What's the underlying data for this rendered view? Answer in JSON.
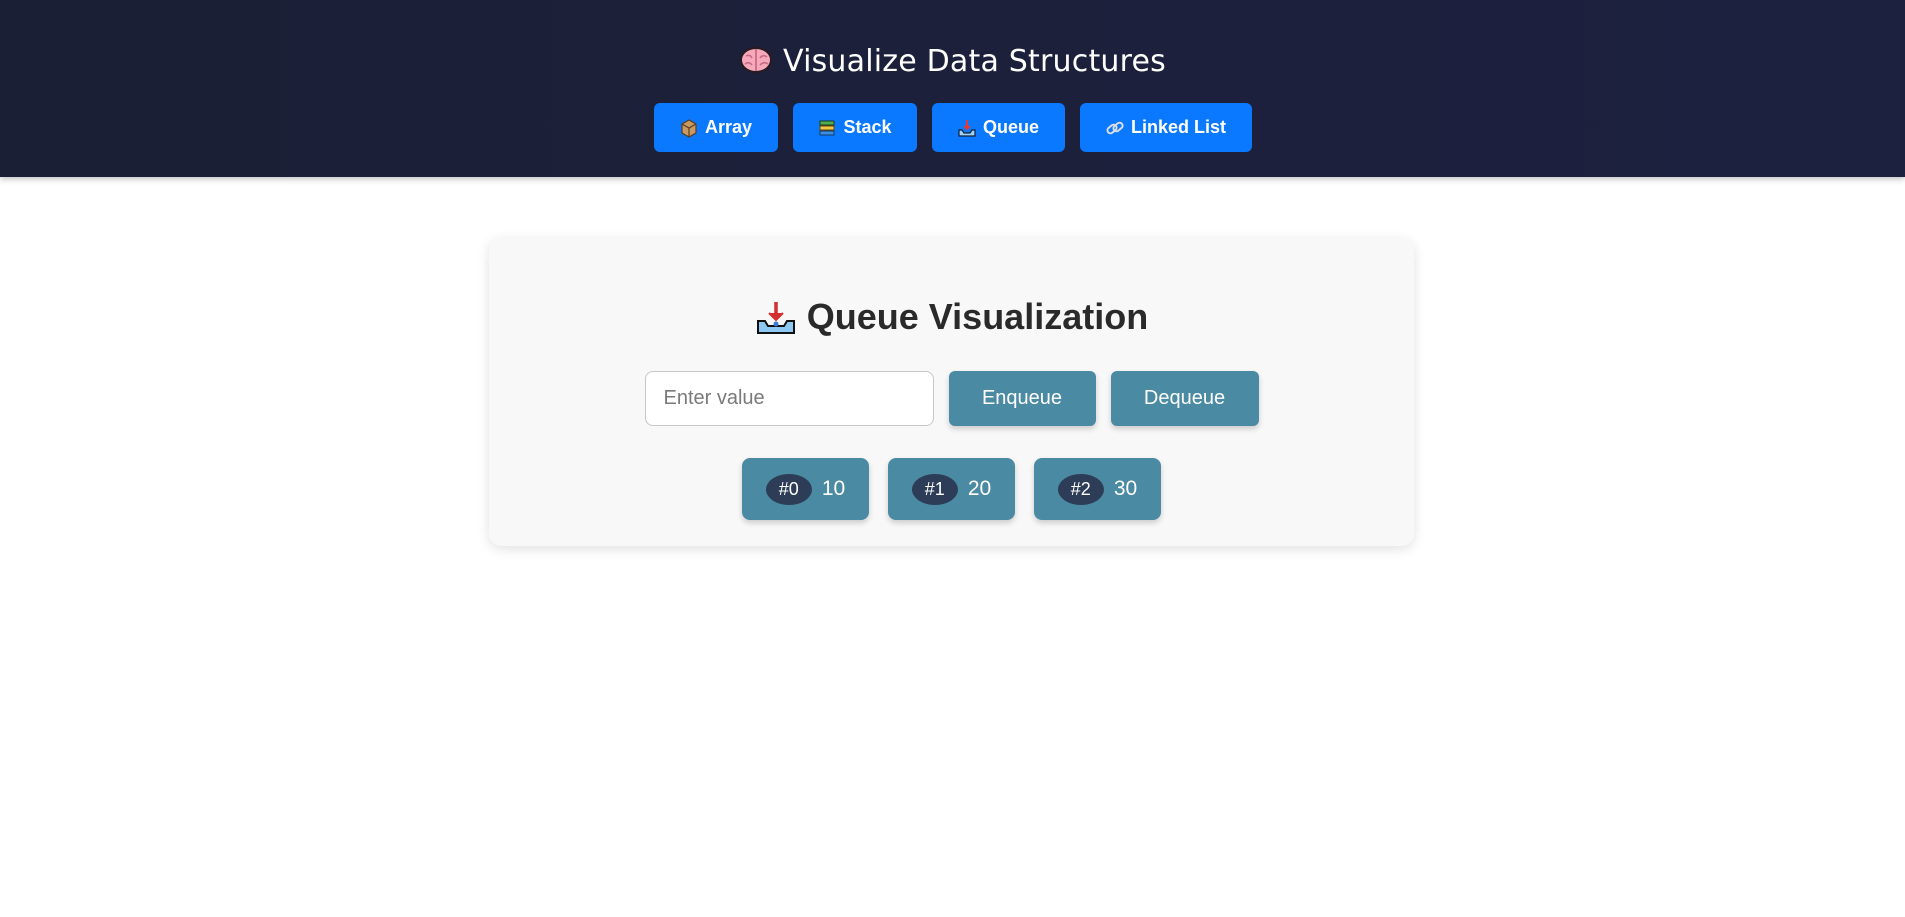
{
  "header": {
    "title": "Visualize Data Structures",
    "title_icon": "brain-icon",
    "nav": [
      {
        "label": "Array",
        "icon": "box-icon"
      },
      {
        "label": "Stack",
        "icon": "books-icon"
      },
      {
        "label": "Queue",
        "icon": "inbox-tray-icon"
      },
      {
        "label": "Linked List",
        "icon": "link-icon"
      }
    ],
    "accent_color": "#0a79ff",
    "background_color": "#1b1f35"
  },
  "panel": {
    "title": "Queue Visualization",
    "title_icon": "inbox-tray-icon",
    "input": {
      "value": "",
      "placeholder": "Enter value"
    },
    "enqueue_label": "Enqueue",
    "dequeue_label": "Dequeue",
    "button_color": "#4b8aa3",
    "queue": [
      {
        "index": "#0",
        "value": "10"
      },
      {
        "index": "#1",
        "value": "20"
      },
      {
        "index": "#2",
        "value": "30"
      }
    ]
  }
}
